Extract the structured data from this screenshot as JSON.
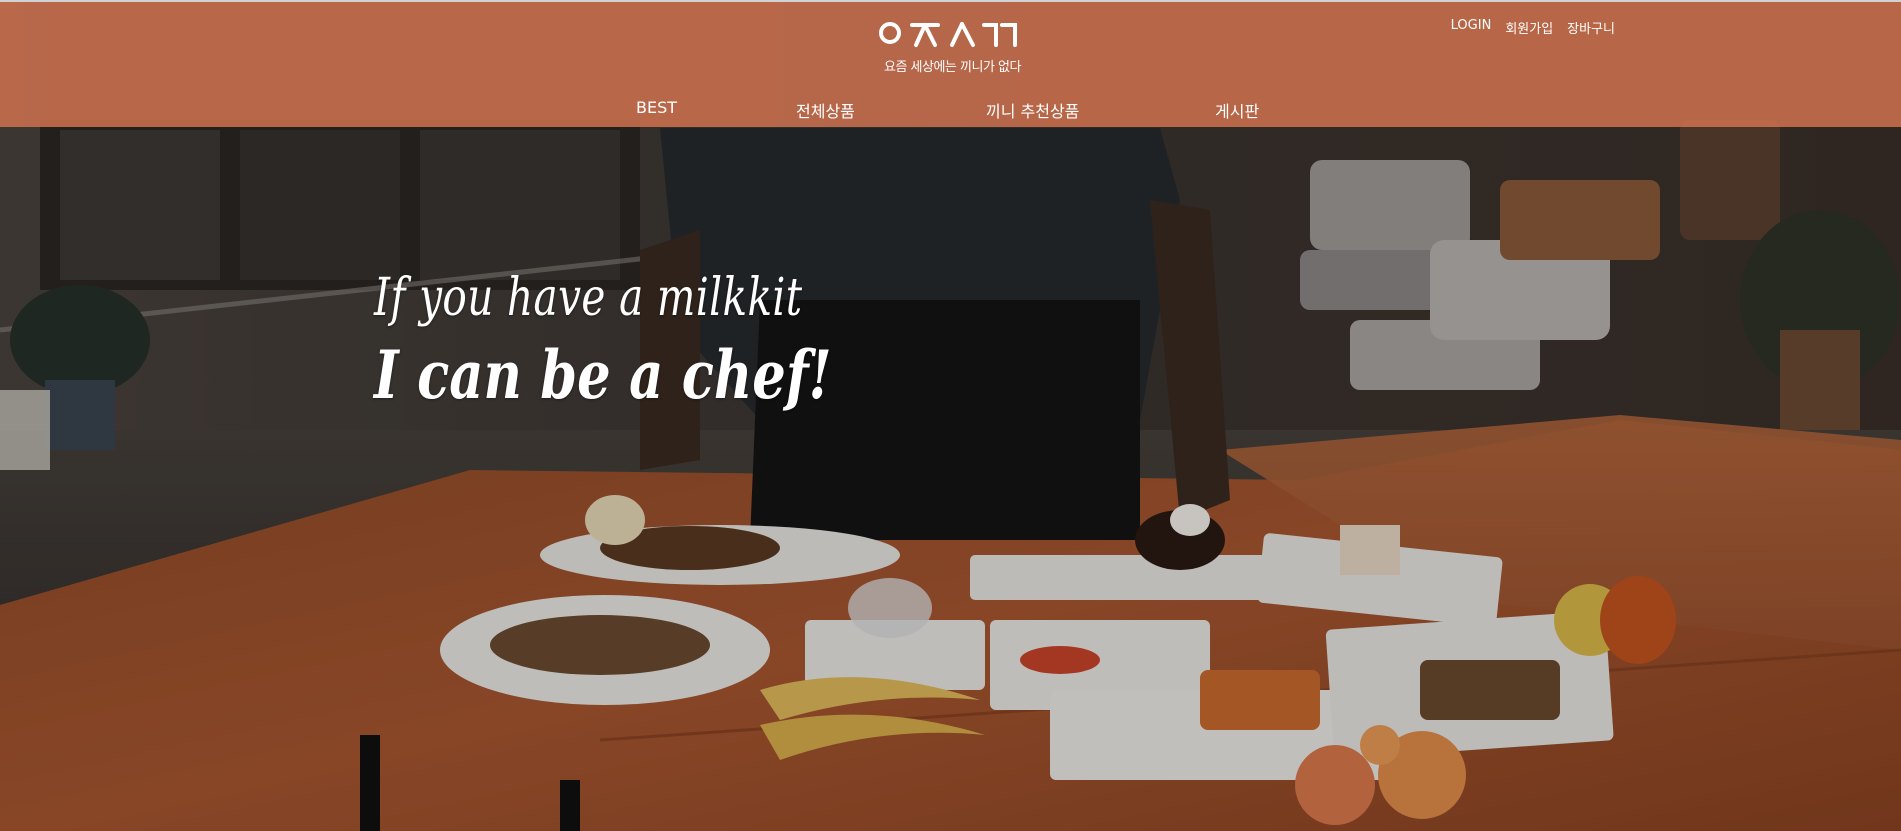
{
  "header": {
    "logo": {
      "mark": "ㅇㅈㅅㄲ",
      "tagline": "요즘 세상에는 끼니가 없다"
    },
    "util_links": [
      "LOGIN",
      "회원가입",
      "장바구니"
    ],
    "nav_items": [
      "BEST",
      "전체상품",
      "끼니 추천상품",
      "게시판"
    ]
  },
  "hero": {
    "line1": "If you have a milkkit",
    "line2": "I can be a chef!"
  },
  "colors": {
    "header_bg": "#c76e4c",
    "text": "#ffffff",
    "table_wood": "#a65630"
  }
}
